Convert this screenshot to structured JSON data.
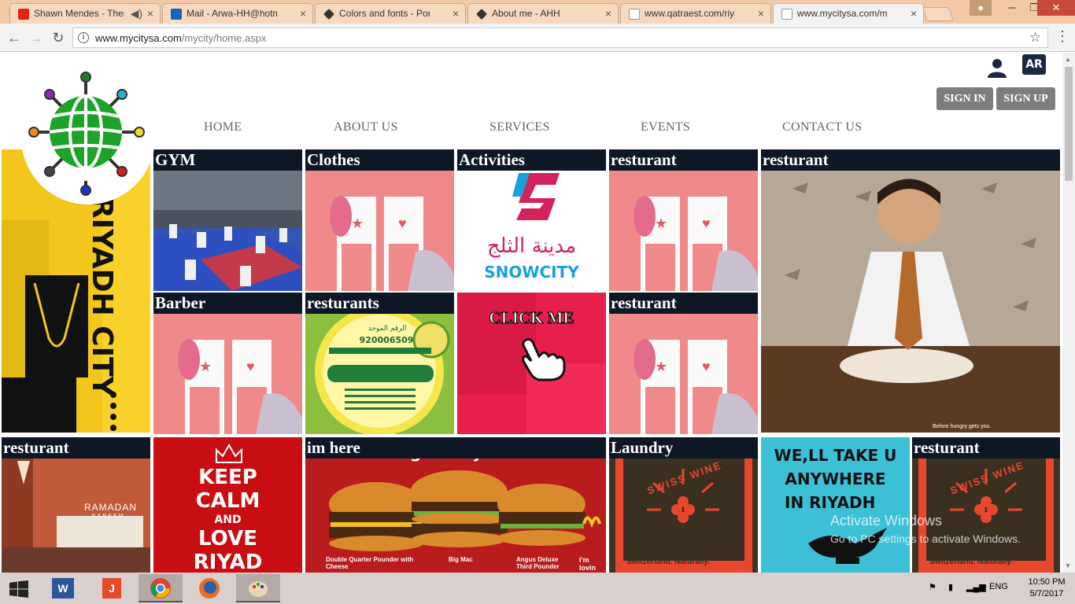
{
  "browser": {
    "tabs": [
      {
        "label": "Shawn Mendes - Ther",
        "icon_color": "#e62117",
        "icon": "youtube-icon"
      },
      {
        "label": "Mail - Arwa-HH@hotma",
        "icon_color": "#1565c0",
        "icon": "outlook-icon"
      },
      {
        "label": "Colors and fonts - Portfo",
        "icon_color": "#333333",
        "icon": "diamond-icon"
      },
      {
        "label": "About me - AHH",
        "icon_color": "#333333",
        "icon": "diamond-icon"
      },
      {
        "label": "www.qatraest.com/riyadh",
        "icon_color": "#999999",
        "icon": "page-icon"
      },
      {
        "label": "www.mycitysa.com/myci",
        "icon_color": "#999999",
        "icon": "page-icon"
      }
    ],
    "url_host": "www.mycitysa.com",
    "url_path": "/mycity/home.aspx"
  },
  "header": {
    "lang_button": "AR",
    "sign_in": "SIGN IN",
    "sign_up": "SIGN UP"
  },
  "nav": {
    "items": [
      "HOME",
      "ABOUT US",
      "SERVICES",
      "EVENTS",
      "CONTACT US"
    ]
  },
  "tiles": {
    "gym": "GYM",
    "clothes": "Clothes",
    "activities": "Activities",
    "resturant_1": "resturant",
    "resturant_big": "resturant",
    "barber": "Barber",
    "resturants": "resturants",
    "resturant_2": "resturant",
    "resturant_3": "resturant",
    "im_here": "im here",
    "laundry": "Laundry",
    "resturant_4": "resturant"
  },
  "images": {
    "riyadh_city_text": "RIYADH CITY",
    "snow_city_ar": "مدينة الثلج",
    "snow_city_en": "SNOWCITY",
    "click_me": "CLICK ME",
    "keep_calm_lines": [
      "KEEP",
      "CALM",
      "AND",
      "LOVE",
      "RIYAD"
    ],
    "take_you_lines": [
      "WE,LL TAKE U",
      "ANYWHERE",
      "IN RIYADH"
    ],
    "ramadan": "RAMADAN",
    "kareem": "KAREEM",
    "swiss_wine": "SWISS WINE",
    "swiss_tagline": "Switzerland. Naturally.",
    "burger_headline": "big. beefy. bliss.",
    "burger_captions": [
      "Double Quarter Pounder with Cheese",
      "Big Mac",
      "Angus Deluxe Third Pounder",
      "i'm lovin"
    ],
    "dominos_tagline": "Before hungry gets you.",
    "fuul_number_label": "الرقم الموحد",
    "fuul_number": "920006509"
  },
  "watermark": {
    "title": "Activate Windows",
    "subtitle": "Go to PC settings to activate Windows."
  },
  "taskbar": {
    "lang": "ENG",
    "time": "10:50 PM",
    "date": "5/7/2017"
  },
  "colors": {
    "nav_caption_bg": "#0d1726",
    "auth_button_bg": "#7d7d7d",
    "lang_button_bg": "#1c2740"
  }
}
